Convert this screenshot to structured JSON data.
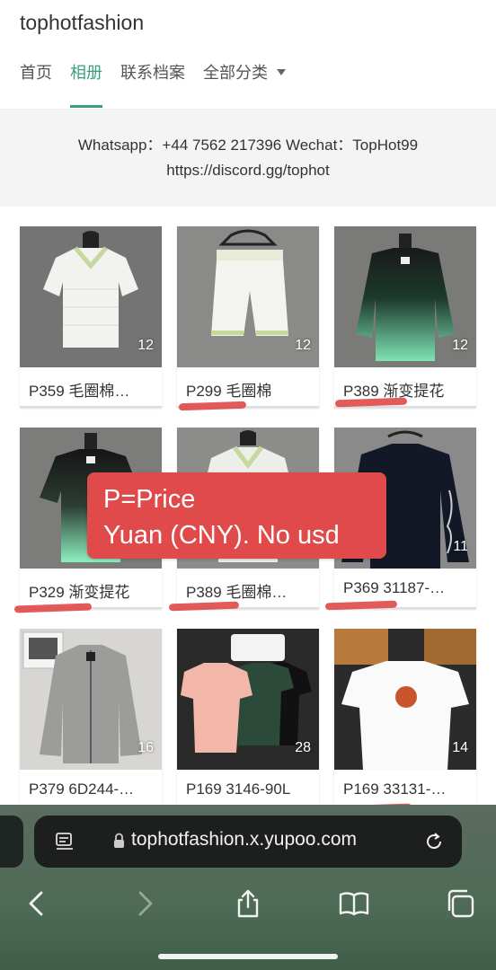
{
  "site": {
    "title": "tophotfashion",
    "nav": [
      {
        "label": "首页"
      },
      {
        "label": "相册"
      },
      {
        "label": "联系档案"
      },
      {
        "label": "全部分类"
      }
    ]
  },
  "contact": {
    "line1": "Whatsapp：+44 7562 217396 Wechat：TopHot99",
    "line2": "https://discord.gg/tophot"
  },
  "albums": [
    {
      "caption": "P359 毛圈棉…",
      "count": "12"
    },
    {
      "caption": "P299 毛圈棉",
      "count": "12"
    },
    {
      "caption": "P389 渐变提花",
      "count": "12"
    },
    {
      "caption": "P329 渐变提花",
      "count": ""
    },
    {
      "caption": "P389 毛圈棉…",
      "count": ""
    },
    {
      "caption": "P369 31187-…",
      "count": "11"
    },
    {
      "caption": "P379 6D244-…",
      "count": "16"
    },
    {
      "caption": "P169 3146-90L",
      "count": "28"
    },
    {
      "caption": "P169 33131-…",
      "count": "14"
    }
  ],
  "overlay": {
    "line1": "P=Price",
    "line2": "Yuan (CNY). No usd"
  },
  "browser": {
    "url": "tophotfashion.x.yupoo.com",
    "icons": [
      "reader-icon",
      "lock-icon",
      "reload-icon",
      "back-icon",
      "forward-icon",
      "share-icon",
      "bookmarks-icon",
      "tabs-icon"
    ]
  },
  "colors": {
    "accent": "#3a9f7f",
    "annotation_red": "#e04a4a",
    "browser_bg": "#4e6b56"
  }
}
